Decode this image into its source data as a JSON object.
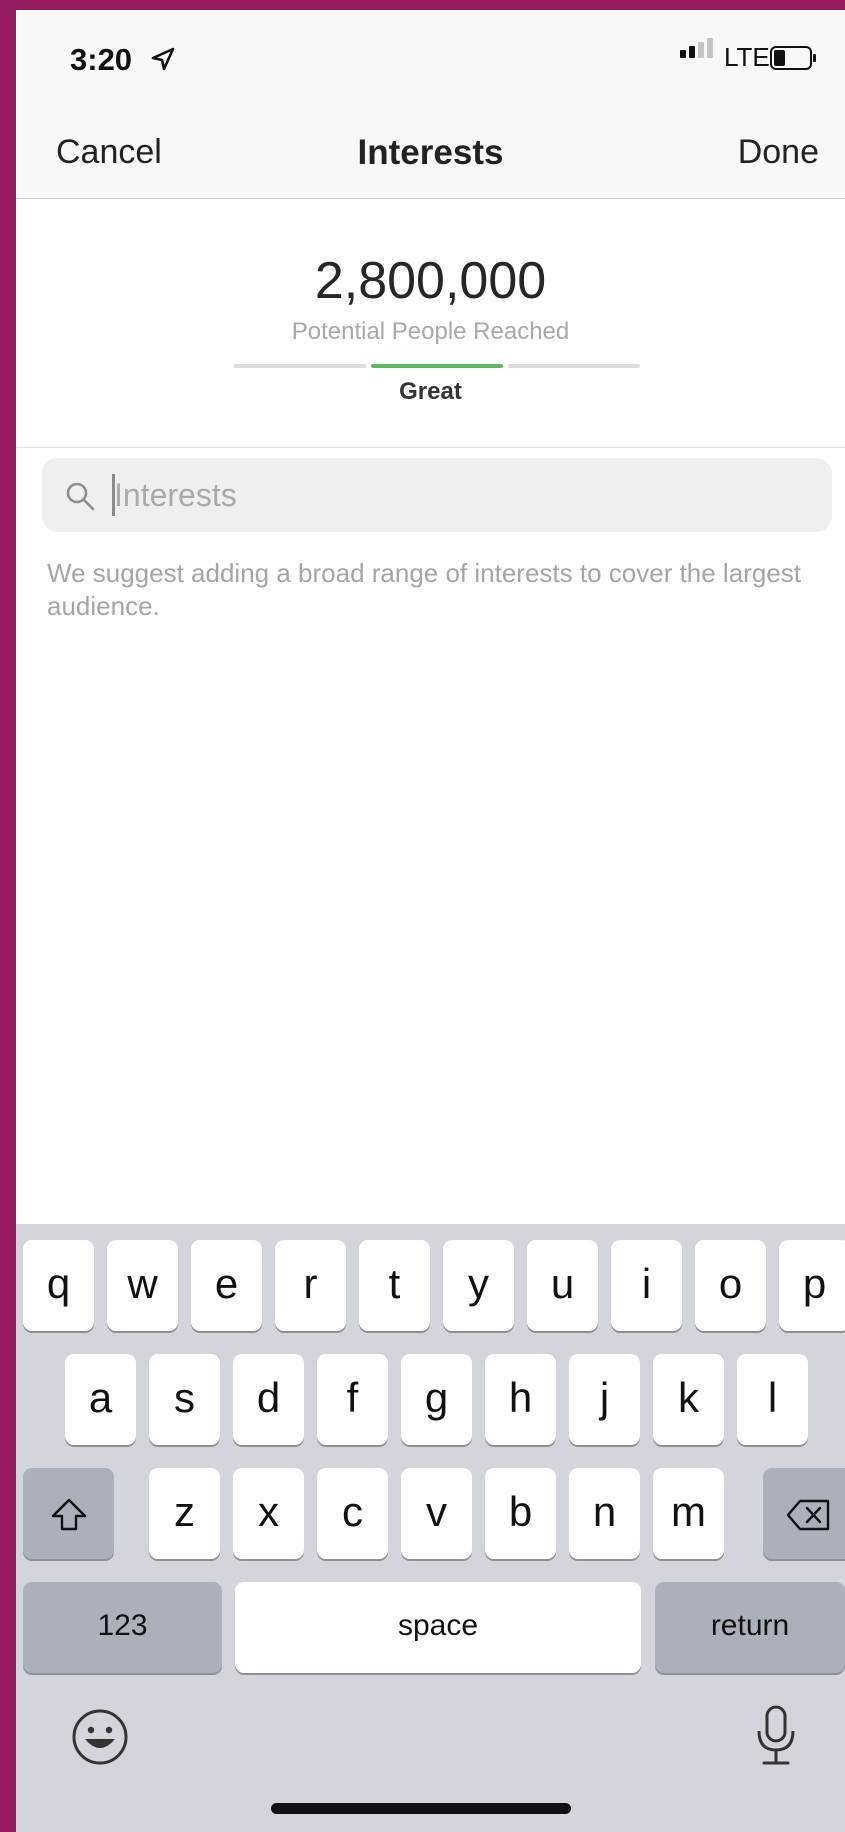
{
  "status_bar": {
    "time": "3:20",
    "network": "LTE"
  },
  "nav": {
    "cancel_label": "Cancel",
    "title": "Interests",
    "done_label": "Done"
  },
  "reach": {
    "count": "2,800,000",
    "label": "Potential People Reached",
    "rating": "Great",
    "meter_active_segment": 2,
    "meter_segments": 3,
    "active_color": "#5cb85c"
  },
  "search": {
    "placeholder": "Interests",
    "value": ""
  },
  "hint": "We suggest adding a broad range of interests to cover the largest audience.",
  "keyboard": {
    "row1": [
      "q",
      "w",
      "e",
      "r",
      "t",
      "y",
      "u",
      "i",
      "o",
      "p"
    ],
    "row2": [
      "a",
      "s",
      "d",
      "f",
      "g",
      "h",
      "j",
      "k",
      "l"
    ],
    "row3": [
      "z",
      "x",
      "c",
      "v",
      "b",
      "n",
      "m"
    ],
    "numbers_label": "123",
    "space_label": "space",
    "return_label": "return",
    "shift_icon": "shift-icon",
    "delete_icon": "delete-icon",
    "emoji_icon": "emoji-icon",
    "mic_icon": "microphone-icon"
  }
}
